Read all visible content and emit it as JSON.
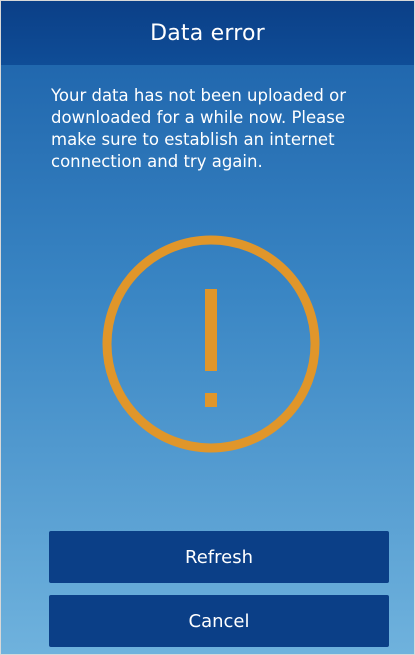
{
  "header": {
    "title": "Data error"
  },
  "message": {
    "text": "Your data has not been uploaded or downloaded for a while now. Please make sure to establish an internet connection and try again."
  },
  "icon": {
    "name": "warning-exclamation-icon",
    "color": "#e0962a"
  },
  "buttons": {
    "refresh_label": "Refresh",
    "cancel_label": "Cancel"
  },
  "colors": {
    "header_bg": "#0b3f87",
    "button_bg": "#0b3f87",
    "text": "#ffffff",
    "background_top": "#1a5fa8",
    "background_bottom": "#6fb2dd"
  }
}
